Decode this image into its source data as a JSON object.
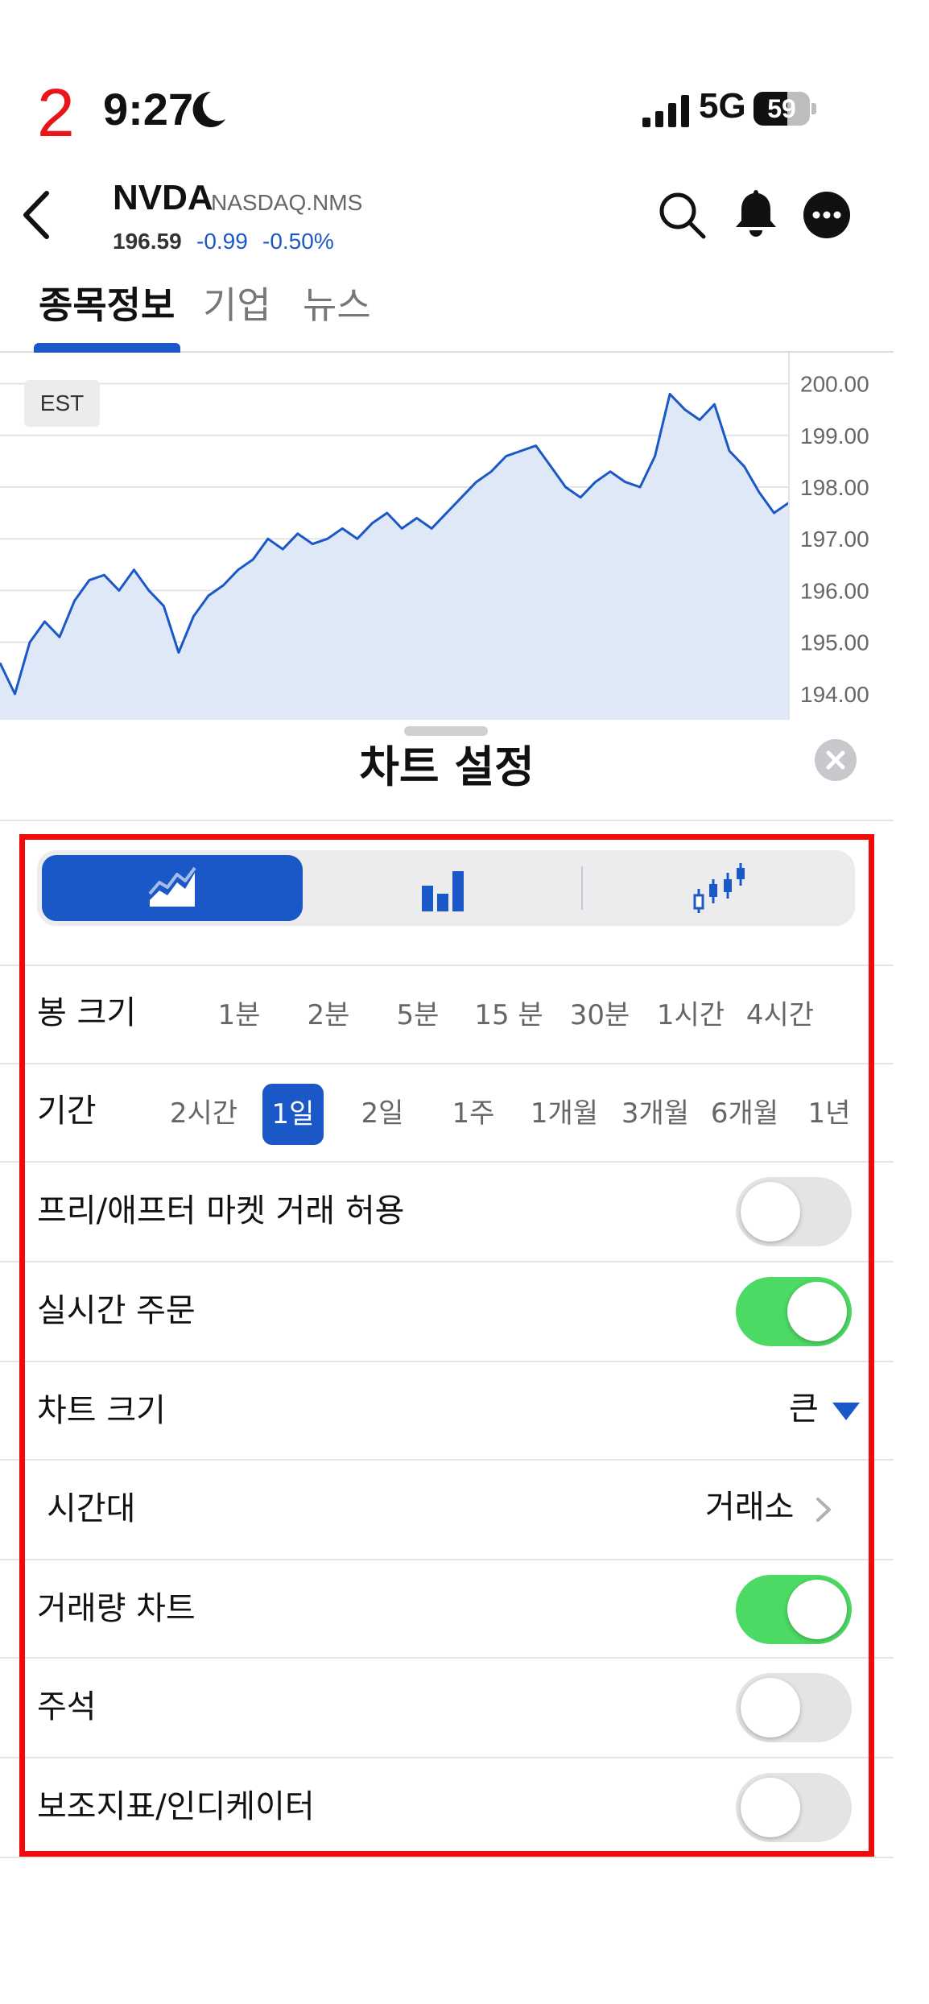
{
  "status_bar": {
    "debug_number": "2",
    "time": "9:27",
    "network": "5G",
    "battery": "59"
  },
  "header": {
    "ticker": "NVDA",
    "exchange": "NASDAQ.NMS",
    "price": "196.59",
    "change": "-0.99",
    "change_percent": "-0.50%"
  },
  "tabs": [
    {
      "label": "종목정보",
      "active": true
    },
    {
      "label": "기업",
      "active": false
    },
    {
      "label": "뉴스",
      "active": false
    }
  ],
  "chart": {
    "timezone_badge": "EST",
    "y_ticks": [
      "200.00",
      "199.00",
      "198.00",
      "197.00",
      "196.00",
      "195.00",
      "194.00"
    ],
    "line_color": "#1b58c7",
    "fill_color": "#dfe8f7"
  },
  "chart_data": {
    "type": "area",
    "title": "",
    "xlabel": "",
    "ylabel": "",
    "ylim": [
      193.7,
      200.2
    ],
    "series": [
      {
        "values": [
          194.6,
          194.0,
          195.0,
          195.4,
          195.1,
          195.8,
          196.2,
          196.3,
          196.0,
          196.4,
          196.0,
          195.7,
          194.8,
          195.5,
          195.9,
          196.1,
          196.4,
          196.6,
          197.0,
          196.8,
          197.1,
          196.9,
          197.0,
          197.2,
          197.0,
          197.3,
          197.5,
          197.2,
          197.4,
          197.2,
          197.5,
          197.8,
          198.1,
          198.3,
          198.6,
          198.7,
          198.8,
          198.4,
          198.0,
          197.8,
          198.1,
          198.3,
          198.1,
          198.0,
          198.6,
          199.8,
          199.5,
          199.3,
          199.6,
          198.7,
          198.4,
          197.9,
          197.5,
          197.7
        ]
      }
    ]
  },
  "sheet": {
    "title": "차트 설정",
    "chart_types": [
      "line-chart",
      "bar-chart",
      "candlestick-chart"
    ],
    "candle_size": {
      "label": "봉 크기",
      "options": [
        "1분",
        "2분",
        "5분",
        "15 분",
        "30분",
        "1시간",
        "4시간"
      ]
    },
    "period": {
      "label": "기간",
      "options": [
        "2시간",
        "1일",
        "2일",
        "1주",
        "1개월",
        "3개월",
        "6개월",
        "1년"
      ],
      "selected": "1일"
    },
    "pre_after_market": {
      "label": "프리/애프터 마켓 거래 허용",
      "on": false
    },
    "realtime_order": {
      "label": "실시간 주문",
      "on": true
    },
    "chart_size": {
      "label": "차트 크기",
      "value": "큰"
    },
    "timezone": {
      "label": "시간대",
      "value": "거래소"
    },
    "volume_chart": {
      "label": "거래량 차트",
      "on": true
    },
    "annotation": {
      "label": "주석",
      "on": false
    },
    "indicators": {
      "label": "보조지표/인디케이터",
      "on": false
    }
  },
  "colors": {
    "accent": "#1b58c7",
    "toggle_on": "#4cd964",
    "highlight_box": "#f00a0a"
  }
}
